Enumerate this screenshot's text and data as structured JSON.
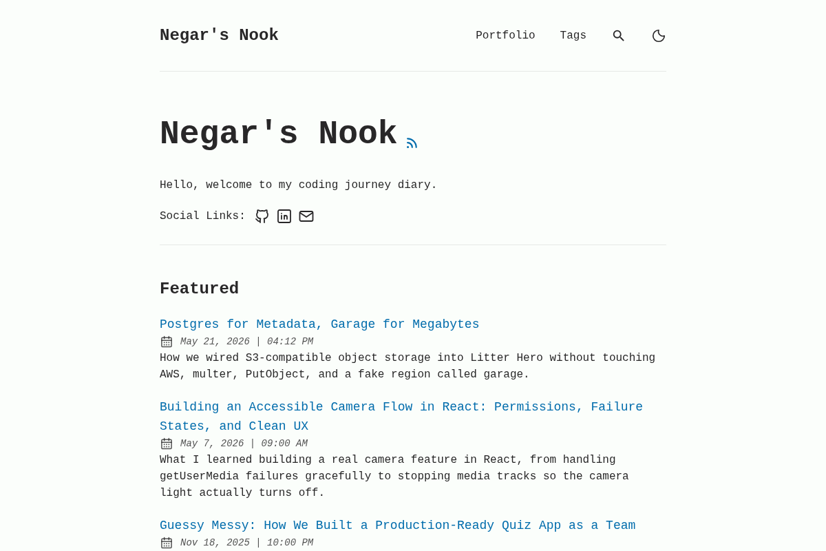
{
  "site_title": "Negar's Nook",
  "nav_links": [
    {
      "label": "Portfolio"
    },
    {
      "label": "Tags"
    }
  ],
  "hero": {
    "title": "Negar's Nook",
    "intro": "Hello, welcome to my coding journey diary.",
    "social_label": "Social Links:"
  },
  "featured": {
    "heading": "Featured",
    "posts": [
      {
        "title": "Postgres for Metadata, Garage for Megabytes",
        "date": "May 21, 2026 | 04:12 PM",
        "description": "How we wired S3-compatible object storage into Litter Hero without touching AWS, multer, PutObject, and a fake region called garage."
      },
      {
        "title": "Building an Accessible Camera Flow in React: Permissions, Failure States, and Clean UX",
        "date": "May 7, 2026 | 09:00 AM",
        "description": "What I learned building a real camera feature in React, from handling getUserMedia failures gracefully to stopping media tracks so the camera light actually turns off."
      },
      {
        "title": "Guessy Messy: How We Built a Production-Ready Quiz App as a Team",
        "date": "Nov 18, 2025 | 10:00 PM"
      }
    ]
  }
}
